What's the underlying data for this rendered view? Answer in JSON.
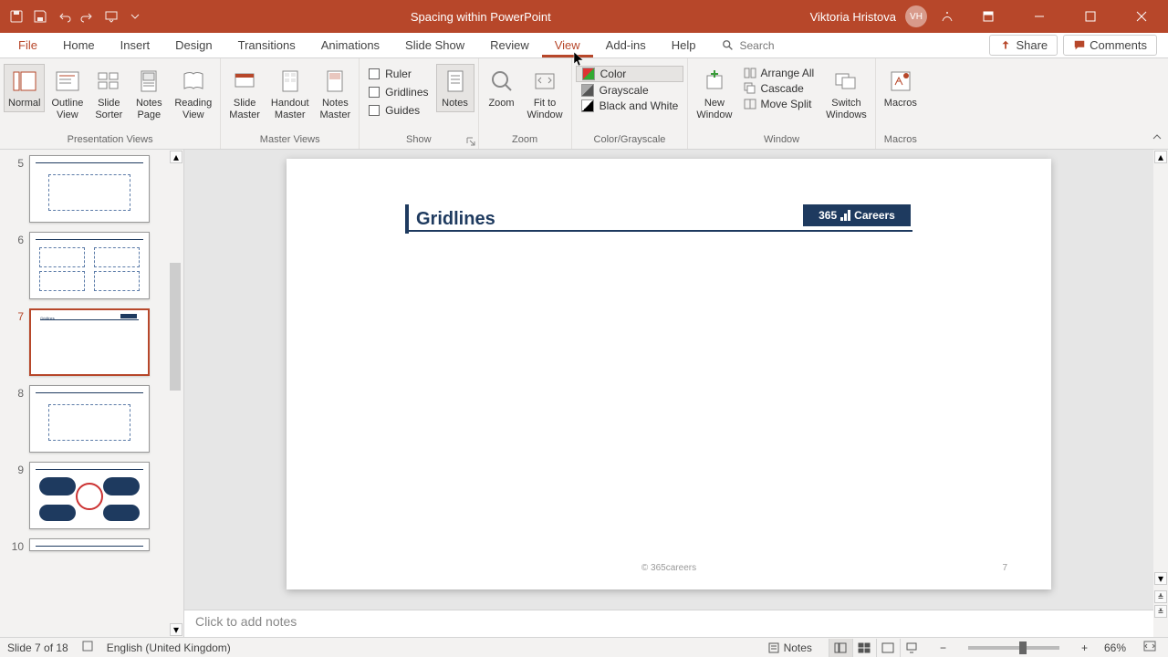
{
  "title": "Spacing within PowerPoint",
  "user": "Viktoria Hristova",
  "user_initials": "VH",
  "tabs": [
    "File",
    "Home",
    "Insert",
    "Design",
    "Transitions",
    "Animations",
    "Slide Show",
    "Review",
    "View",
    "Add-ins",
    "Help"
  ],
  "active_tab": "View",
  "search_placeholder": "Search",
  "share": "Share",
  "comments": "Comments",
  "ribbon": {
    "presentation_views": {
      "label": "Presentation Views",
      "normal": "Normal",
      "outline": "Outline\nView",
      "sorter": "Slide\nSorter",
      "notes_page": "Notes\nPage",
      "reading": "Reading\nView"
    },
    "master_views": {
      "label": "Master Views",
      "slide_master": "Slide\nMaster",
      "handout": "Handout\nMaster",
      "notes_master": "Notes\nMaster"
    },
    "show": {
      "label": "Show",
      "ruler": "Ruler",
      "gridlines": "Gridlines",
      "guides": "Guides",
      "notes": "Notes"
    },
    "zoom": {
      "label": "Zoom",
      "zoom": "Zoom",
      "fit": "Fit to\nWindow"
    },
    "color": {
      "label": "Color/Grayscale",
      "color": "Color",
      "grayscale": "Grayscale",
      "bw": "Black and White"
    },
    "window": {
      "label": "Window",
      "new": "New\nWindow",
      "arrange": "Arrange All",
      "cascade": "Cascade",
      "move_split": "Move Split",
      "switch": "Switch\nWindows"
    },
    "macros": {
      "label": "Macros",
      "macros": "Macros"
    }
  },
  "thumbs": [
    {
      "num": "",
      "type": "partial"
    },
    {
      "num": "5",
      "type": "single-box"
    },
    {
      "num": "6",
      "type": "four-box"
    },
    {
      "num": "7",
      "type": "title-only",
      "active": true
    },
    {
      "num": "8",
      "type": "single-box"
    },
    {
      "num": "9",
      "type": "complex"
    },
    {
      "num": "10",
      "type": "partial-bottom"
    }
  ],
  "slide": {
    "title": "Gridlines",
    "logo_text": "365",
    "logo_suffix": "Careers",
    "footer": "© 365careers",
    "page": "7"
  },
  "notes_placeholder": "Click to add notes",
  "status": {
    "slide": "Slide 7 of 18",
    "lang": "English (United Kingdom)",
    "notes": "Notes",
    "zoom": "66%"
  }
}
